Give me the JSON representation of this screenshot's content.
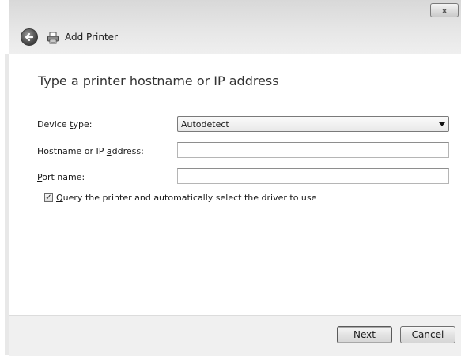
{
  "window": {
    "title": "Add Printer",
    "close_glyph": "x",
    "colors": {
      "header_top": "#d8d8d8",
      "header_bottom": "#efefef",
      "footer_bg": "#f0f0f0"
    }
  },
  "header": {
    "back_icon": "back-arrow-icon",
    "app_icon": "printer-icon"
  },
  "content": {
    "heading": "Type a printer hostname or IP address",
    "device_type": {
      "label_pre": "Device ",
      "label_accel": "t",
      "label_post": "ype:",
      "selected": "Autodetect"
    },
    "hostname": {
      "label_pre": "Hostname or IP ",
      "label_accel": "a",
      "label_post": "ddress:",
      "value": ""
    },
    "port": {
      "label_pre": "",
      "label_accel": "P",
      "label_post": "ort name:",
      "value": ""
    },
    "query": {
      "checked": true,
      "label_accel": "Q",
      "label_rest": "uery the printer and automatically select the driver to use",
      "check_glyph": "✓"
    }
  },
  "footer": {
    "next_label": "Next",
    "cancel_label": "Cancel"
  }
}
